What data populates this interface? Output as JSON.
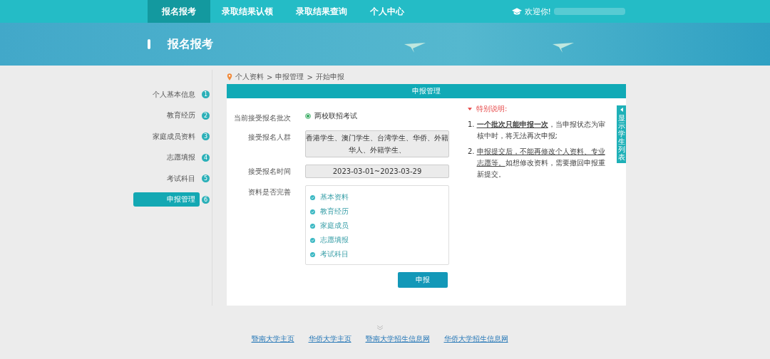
{
  "nav": {
    "items": [
      {
        "label": "报名报考",
        "selected": true
      },
      {
        "label": "录取结果认领",
        "selected": false
      },
      {
        "label": "录取结果查询",
        "selected": false
      },
      {
        "label": "个人中心",
        "selected": false
      }
    ],
    "welcome": "欢迎你!"
  },
  "banner": {
    "title": "报名报考"
  },
  "steps": [
    {
      "label": "个人基本信息",
      "number": "1",
      "selected": false
    },
    {
      "label": "教育经历",
      "number": "2",
      "selected": false
    },
    {
      "label": "家庭成员资料",
      "number": "3",
      "selected": false
    },
    {
      "label": "志愿填报",
      "number": "4",
      "selected": false
    },
    {
      "label": "考试科目",
      "number": "5",
      "selected": false
    },
    {
      "label": "申报管理",
      "number": "6",
      "selected": true
    }
  ],
  "breadcrumb": {
    "separator": ">",
    "items": [
      "个人资料",
      "申报管理",
      "开始申报"
    ]
  },
  "panel": {
    "title": "申报管理",
    "batch": {
      "label": "当前接受报名批次",
      "option": "两校联招考试",
      "selected": true
    },
    "group": {
      "label": "接受报名人群",
      "value": "香港学生、澳门学生、台湾学生、华侨、外籍华人、外籍学生、"
    },
    "period": {
      "label": "接受报名时间",
      "value": "2023-03-01~2023-03-29"
    },
    "complete": {
      "label": "资料是否完善",
      "items": [
        {
          "label": "基本资料",
          "checked": true
        },
        {
          "label": "教育经历",
          "checked": true
        },
        {
          "label": "家庭成员",
          "checked": true
        },
        {
          "label": "志愿填报",
          "checked": true
        },
        {
          "label": "考试科目",
          "checked": true
        }
      ]
    },
    "submit": "申报",
    "notes_title": "特别说明:",
    "notes": [
      {
        "number": "1.",
        "lead": "**一个批次只能申报一次**",
        "rest": "，当申报状态为审核中时，将无法再次申报;"
      },
      {
        "number": "2.",
        "lead": "申报提交后，不能再修改个人资料、专业志愿等。",
        "rest": "如想修改资料，需要撤回申报重新提交。"
      }
    ],
    "side_tab": "显示学生列表"
  },
  "footer_links": [
    "暨南大学主页",
    "华侨大学主页",
    "暨南大学招生信息网",
    "华侨大学招生信息网"
  ]
}
